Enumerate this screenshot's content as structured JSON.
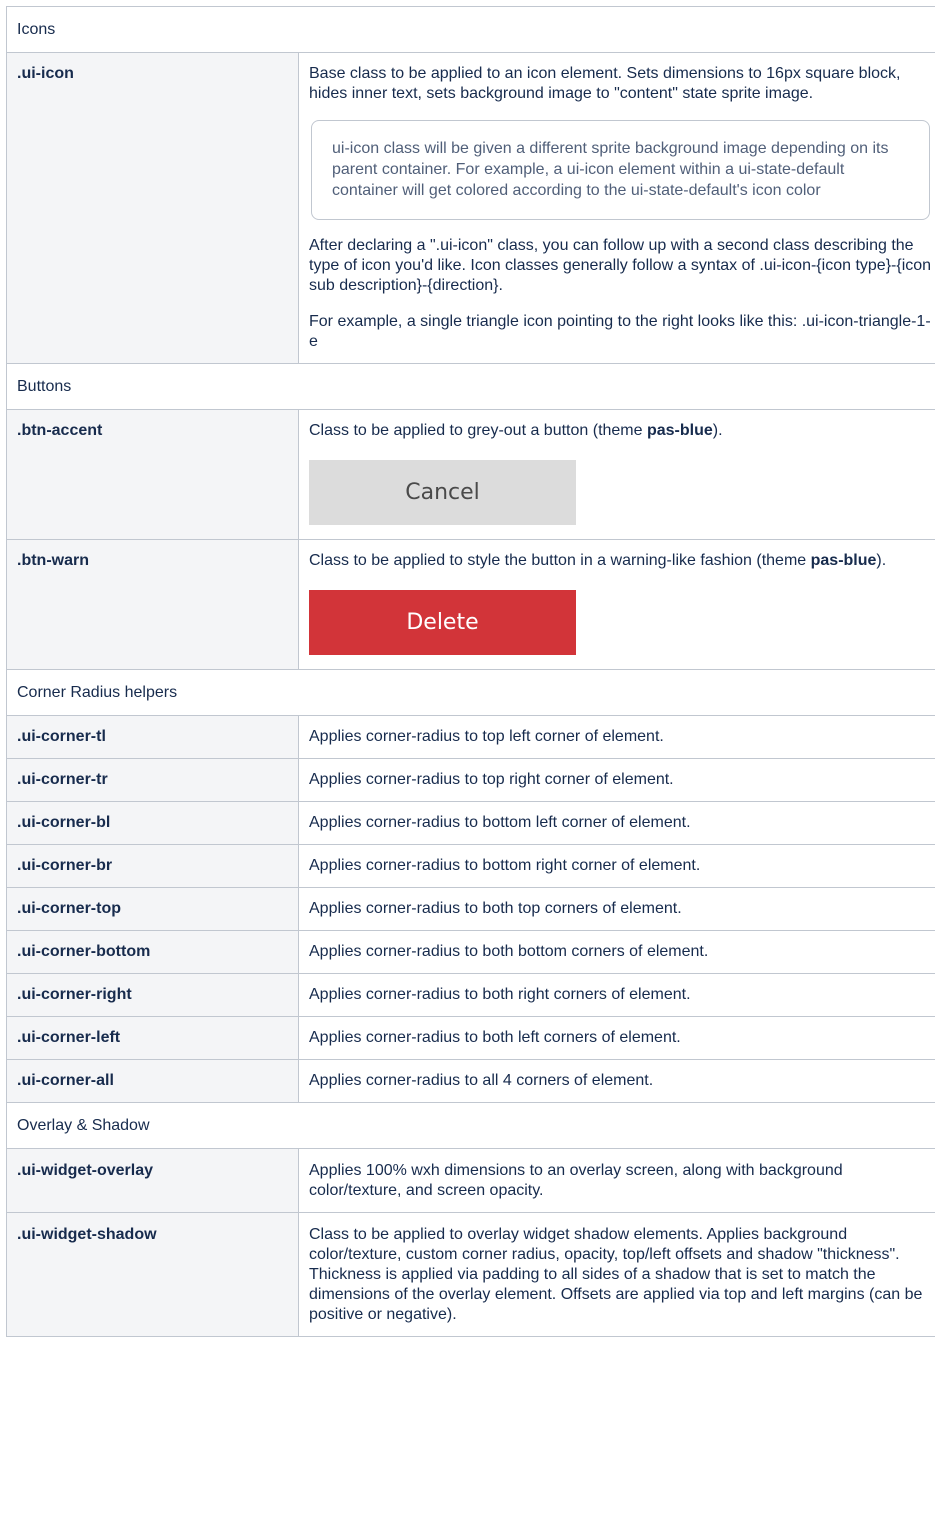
{
  "sections": {
    "icons": "Icons",
    "buttons": "Buttons",
    "corner": "Corner Radius helpers",
    "overlay": "Overlay & Shadow"
  },
  "ui_icon": {
    "name": ".ui-icon",
    "desc": "Base class to be applied to an icon element. Sets dimensions to 16px square block, hides inner text, sets background image to \"content\" state sprite image.",
    "note": "ui-icon class will be given a different sprite background image depending on its parent container. For example, a ui-icon element within a ui-state-default container will get colored according to the ui-state-default's icon color",
    "para2": "After declaring a \".ui-icon\" class, you can follow up with a second class describing the type of icon you'd like. Icon classes generally follow a syntax of .ui-icon-{icon type}-{icon sub description}-{direction}.",
    "para3": "For example, a single triangle icon pointing to the right looks like this: .ui-icon-triangle-1-e"
  },
  "btn_accent": {
    "name": ".btn-accent",
    "desc_pre": "Class to be applied to grey-out a button (theme ",
    "theme": "pas-blue",
    "desc_post": ").",
    "button_label": "Cancel"
  },
  "btn_warn": {
    "name": ".btn-warn",
    "desc_pre": "Class to be applied to style the button in a warning-like fashion (theme ",
    "theme": "pas-blue",
    "desc_post": ").",
    "button_label": "Delete"
  },
  "corners": [
    {
      "name": ".ui-corner-tl",
      "desc": "Applies corner-radius to top left corner of element."
    },
    {
      "name": ".ui-corner-tr",
      "desc": "Applies corner-radius to top right corner of element."
    },
    {
      "name": ".ui-corner-bl",
      "desc": "Applies corner-radius to bottom left corner of element."
    },
    {
      "name": ".ui-corner-br",
      "desc": "Applies corner-radius to bottom right corner of element."
    },
    {
      "name": ".ui-corner-top",
      "desc": "Applies corner-radius to both top corners of element."
    },
    {
      "name": ".ui-corner-bottom",
      "desc": "Applies corner-radius to both bottom corners of element."
    },
    {
      "name": ".ui-corner-right",
      "desc": "Applies corner-radius to both right corners of element."
    },
    {
      "name": ".ui-corner-left",
      "desc": "Applies corner-radius to both left corners of element."
    },
    {
      "name": ".ui-corner-all",
      "desc": "Applies corner-radius to all 4 corners of element."
    }
  ],
  "overlay": {
    "name": ".ui-widget-overlay",
    "desc": "Applies 100% wxh dimensions to an overlay screen, along with background color/texture, and screen opacity."
  },
  "shadow": {
    "name": ".ui-widget-shadow",
    "desc": "Class to be applied to overlay widget shadow elements. Applies background color/texture, custom corner radius, opacity, top/left offsets and shadow \"thickness\". Thickness is applied via padding to all sides of a shadow that is set to match the dimensions of the overlay element. Offsets are applied via top and left margins (can be positive or negative)."
  },
  "colors": {
    "delete_button": "#d23439",
    "cancel_button": "#dcdcdc",
    "header_cell": "#f4f5f7",
    "border": "#c1c7d0"
  }
}
